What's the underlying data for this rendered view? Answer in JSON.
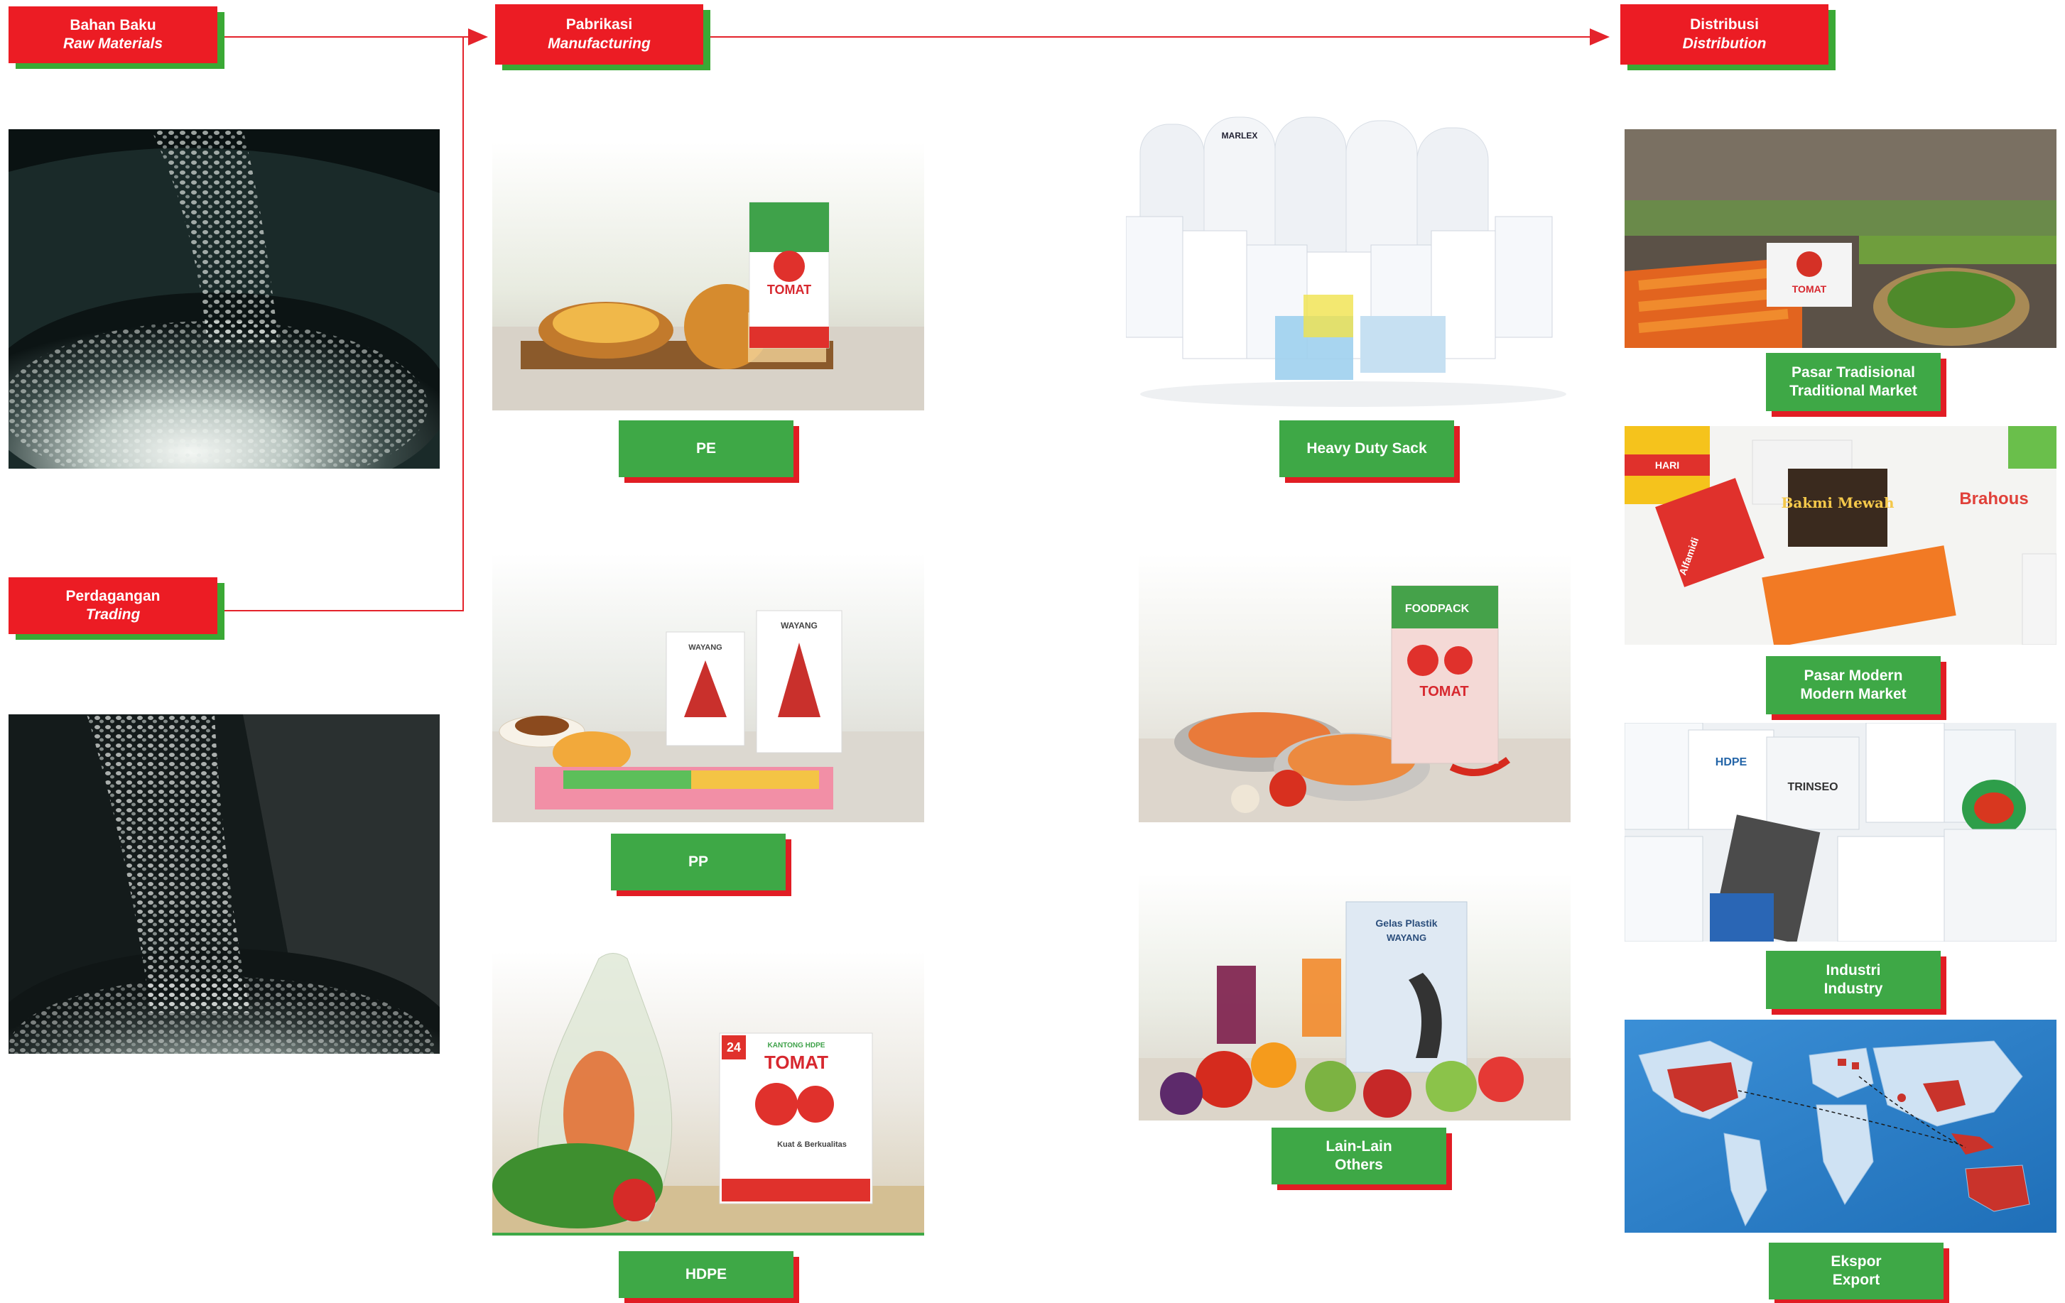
{
  "headers": {
    "raw": {
      "line1": "Bahan Baku",
      "line2": "Raw Materials"
    },
    "trading": {
      "line1": "Perdagangan",
      "line2": "Trading"
    },
    "manufacturing": {
      "line1": "Pabrikasi",
      "line2": "Manufacturing"
    },
    "distribution": {
      "line1": "Distribusi",
      "line2": "Distribution"
    }
  },
  "products": {
    "pe": "PE",
    "pp": "PP",
    "hdpe": "HDPE",
    "heavy_duty": "Heavy Duty Sack",
    "others": {
      "line1": "Lain-Lain",
      "line2": "Others"
    }
  },
  "channels": {
    "traditional": {
      "line1": "Pasar Tradisional",
      "line2": "Traditional Market"
    },
    "modern": {
      "line1": "Pasar Modern",
      "line2": "Modern Market"
    },
    "industry": {
      "line1": "Industri",
      "line2": "Industry"
    },
    "export": {
      "line1": "Ekspor",
      "line2": "Export"
    }
  },
  "packaging_text": {
    "tomat": "TOMAT",
    "wayang": "WAYANG",
    "foodpack": "FOODPACK",
    "gelas_plastik": "Gelas Plastik",
    "kantong_hdpe": "KANTONG HDPE",
    "kuat": "Kuat & Berkualitas",
    "badge_24": "24",
    "marlex": "MARLEX",
    "bakmi_mewah": "Bakmi Mewah",
    "alfamidi": "Alfamidi",
    "brahous": "Brahous",
    "trinseo": "TRINSEO",
    "hdpe_mark": "HDPE",
    "hari": "HARI"
  },
  "colors": {
    "red": "#ec1c24",
    "green": "#3ea846",
    "arrow": "#e4232b"
  }
}
